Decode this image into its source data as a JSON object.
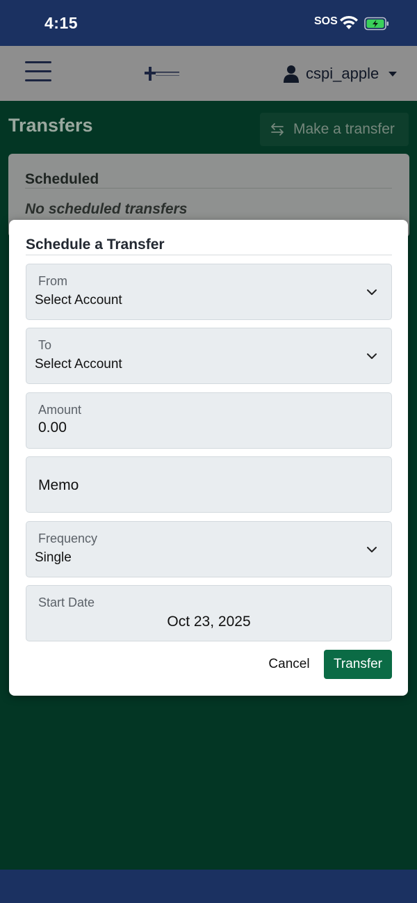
{
  "status_bar": {
    "time": "4:15",
    "sos": "SOS"
  },
  "header": {
    "username": "cspi_apple",
    "icons": [
      "hamburger-menu-icon",
      "bank-logo",
      "user-icon",
      "caret-down-icon"
    ]
  },
  "page": {
    "title": "Transfers",
    "make_transfer_label": "Make a transfer",
    "scheduled": {
      "heading": "Scheduled",
      "empty_text": "No scheduled transfers"
    }
  },
  "modal": {
    "title": "Schedule a Transfer",
    "fields": {
      "from": {
        "label": "From",
        "value": "Select Account"
      },
      "to": {
        "label": "To",
        "value": "Select Account"
      },
      "amount": {
        "label": "Amount",
        "value": "0.00"
      },
      "memo": {
        "placeholder": "Memo"
      },
      "frequency": {
        "label": "Frequency",
        "value": "Single"
      },
      "start_date": {
        "label": "Start Date",
        "value": "Oct 23, 2025"
      }
    },
    "cancel_label": "Cancel",
    "transfer_label": "Transfer"
  },
  "colors": {
    "brand_navy": "#1b3161",
    "page_green": "#033624",
    "primary_button": "#0b6b45"
  }
}
